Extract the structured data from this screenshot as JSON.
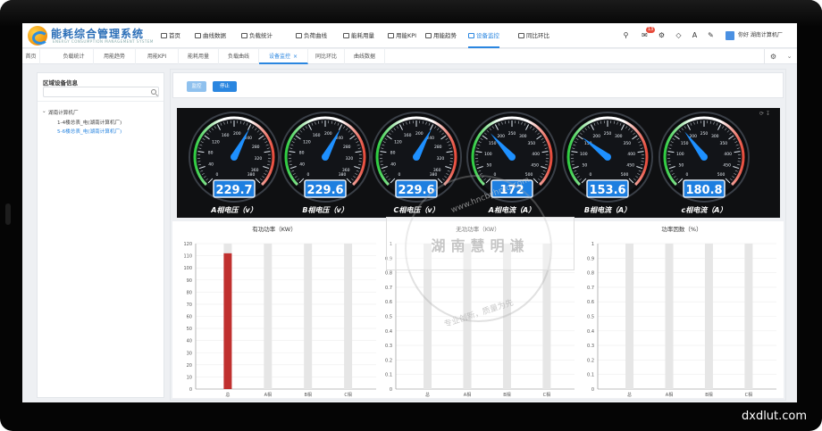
{
  "app": {
    "title": "能耗综合管理系统",
    "subtitle": "ENERGY CONSUMPTION MANAGEMENT SYSTEM"
  },
  "topnav": {
    "items": [
      {
        "label": "首页",
        "icon": "home-icon"
      },
      {
        "label": "曲线数据",
        "icon": "area-chart-icon"
      },
      {
        "label": "负载统计",
        "icon": "pie-chart-icon"
      },
      {
        "label": "负荷曲线",
        "icon": "line-chart-icon"
      },
      {
        "label": "能耗用量",
        "icon": "bar-chart-icon"
      },
      {
        "label": "用能KPI",
        "icon": "bar-chart-icon"
      },
      {
        "label": "用能趋势",
        "icon": "line-chart-icon"
      },
      {
        "label": "设备监控",
        "icon": "monitor-icon"
      },
      {
        "label": "同比环比",
        "icon": "line-chart-icon"
      }
    ],
    "active_index": 7,
    "notification_count": "13",
    "user": "你好 湖南计算机厂"
  },
  "tabs": {
    "items": [
      "首页",
      "负载统计",
      "用能趋势",
      "用能KPI",
      "能耗用量",
      "负载曲线",
      "设备监控",
      "同比环比",
      "曲线数据"
    ],
    "active_index": 6,
    "close_glyph": "×"
  },
  "sidebar": {
    "title": "区域设备信息",
    "search_placeholder": "",
    "tree_root": "湖南计算机厂",
    "tree_children": [
      "1-4楼总表_电(湖南计算机厂)",
      "5-6楼总表_电(湖南计算机厂)"
    ],
    "selected_index": 1
  },
  "controls": {
    "start_label": "监控",
    "stop_label": "停止"
  },
  "gauges": [
    {
      "label": "A相电压（v）",
      "value": 229.7,
      "max": 380,
      "ticks": [
        0,
        40,
        80,
        120,
        160,
        200,
        240,
        280,
        320,
        360,
        380
      ]
    },
    {
      "label": "B相电压（v）",
      "value": 229.6,
      "max": 380,
      "ticks": [
        0,
        40,
        80,
        120,
        160,
        200,
        240,
        280,
        320,
        360,
        380
      ]
    },
    {
      "label": "C相电压（v）",
      "value": 229.6,
      "max": 380,
      "ticks": [
        0,
        40,
        80,
        120,
        160,
        200,
        240,
        280,
        320,
        360,
        380
      ]
    },
    {
      "label": "A相电流（A）",
      "value": 172,
      "max": 500,
      "ticks": [
        0,
        50,
        100,
        150,
        200,
        250,
        300,
        350,
        400,
        450,
        500
      ]
    },
    {
      "label": "B相电流（A）",
      "value": 153.6,
      "max": 500,
      "ticks": [
        0,
        50,
        100,
        150,
        200,
        250,
        300,
        350,
        400,
        450,
        500
      ]
    },
    {
      "label": "c相电流（A）",
      "value": 180.8,
      "max": 500,
      "ticks": [
        0,
        50,
        100,
        150,
        200,
        250,
        300,
        350,
        400,
        450,
        500
      ]
    }
  ],
  "colors": {
    "accent": "#2a86e0",
    "bar": "#c0302f",
    "bar_bg": "#e6e6e6",
    "gauge_needle": "#1e90ff",
    "gauge_box": "#1e7fe0"
  },
  "chart_data": [
    {
      "type": "bar",
      "title": "有功功率（KW）",
      "categories": [
        "总",
        "A相",
        "B相",
        "C相"
      ],
      "values": [
        112,
        0,
        0,
        0
      ],
      "ylim": [
        0,
        120
      ],
      "yticks": [
        0,
        10,
        20,
        30,
        40,
        50,
        60,
        70,
        80,
        90,
        100,
        110,
        120
      ]
    },
    {
      "type": "bar",
      "title": "无功功率（KW）",
      "categories": [
        "总",
        "A相",
        "B相",
        "C相"
      ],
      "values": [
        0,
        0,
        0,
        0
      ],
      "ylim": [
        0,
        1
      ],
      "yticks": [
        0,
        0.1,
        0.2,
        0.3,
        0.4,
        0.5,
        0.6,
        0.7,
        0.8,
        0.9,
        1
      ]
    },
    {
      "type": "bar",
      "title": "功率因数（%）",
      "categories": [
        "总",
        "A相",
        "B相",
        "C相"
      ],
      "values": [
        0,
        0,
        0,
        0
      ],
      "ylim": [
        0,
        1
      ],
      "yticks": [
        0,
        0.1,
        0.2,
        0.3,
        0.4,
        0.5,
        0.6,
        0.7,
        0.8,
        0.9,
        1
      ]
    }
  ],
  "watermark": {
    "main": "湖南慧明谦",
    "slogan": "专业创新，质量为先",
    "url": "www.hncbyhmq.com"
  },
  "site_url": "dxdlut.com"
}
